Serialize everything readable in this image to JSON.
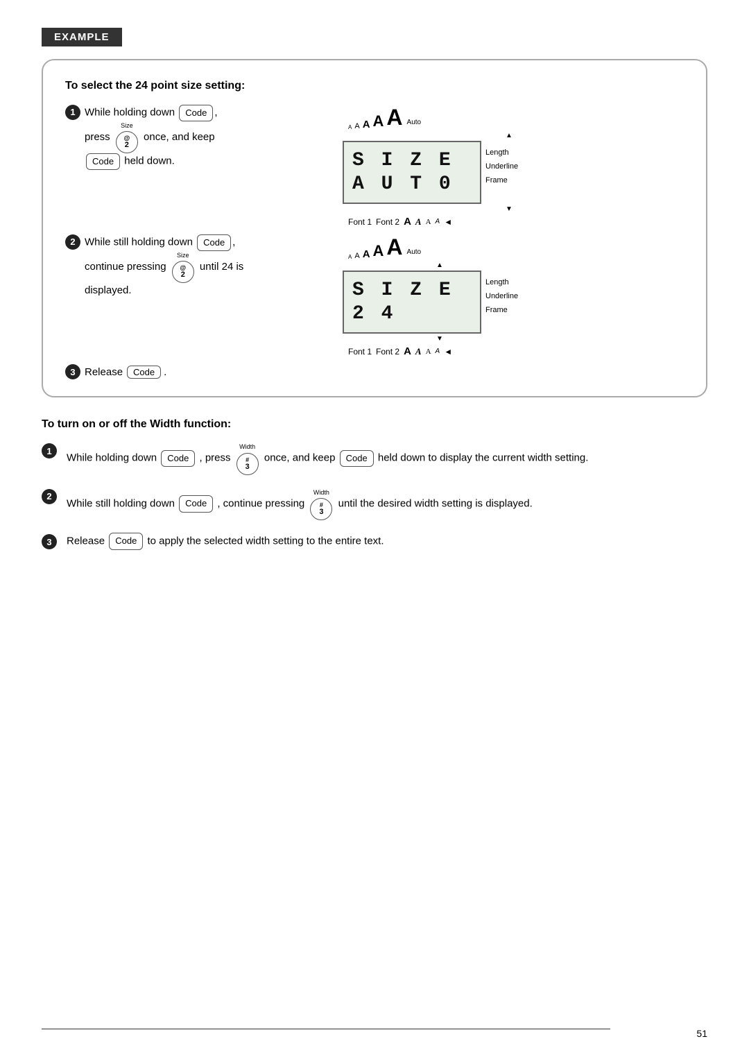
{
  "badge": "EXAMPLE",
  "example_box": {
    "title": "To select the 24 point size setting:",
    "step1": {
      "num": "1",
      "text_before": "While  holding  down",
      "key_code": "Code",
      "text_middle": ",",
      "key_size_label": "Size",
      "key_at_top": "@",
      "key_at_bot": "2",
      "text_after": "once,  and  keep",
      "key_code2": "Code",
      "text_end": "held down."
    },
    "step2": {
      "num": "2",
      "text_before": "While still holding down",
      "key_code": "Code",
      "text_middle": ",",
      "key_size_label": "Size",
      "key_at_top": "@",
      "key_at_bot": "2",
      "text_after": "until 24 is",
      "text_continue": "continue pressing",
      "text_displayed": "displayed."
    },
    "step3": {
      "num": "3",
      "text_before": "Release",
      "key_code": "Code",
      "text_after": "."
    },
    "display1": {
      "line1": "S I Z E",
      "line2": "A U T 0",
      "a_sizes": [
        "A",
        "A",
        "A",
        "A",
        "A"
      ],
      "auto_label": "Auto",
      "arrow_up": "▲",
      "arrow_down": "▼",
      "right_labels": [
        "Length",
        "Underline",
        "Frame"
      ],
      "font_row": [
        "Font 1",
        "Font 2",
        "A",
        "𝔸",
        "𝒜",
        "A",
        "◄"
      ]
    },
    "display2": {
      "line1": "S I Z E",
      "line2": "2 4",
      "a_sizes": [
        "A",
        "A",
        "A",
        "A",
        "A"
      ],
      "auto_label": "Auto",
      "arrow_up": "▲",
      "arrow_down": "▼",
      "right_labels": [
        "Length",
        "Underline",
        "Frame"
      ],
      "font_row": [
        "Font 1",
        "Font 2",
        "A",
        "𝔸",
        "𝒜",
        "A",
        "◄"
      ]
    }
  },
  "width_section": {
    "title": "To turn on or off the Width function:",
    "step1": {
      "num": "1",
      "text": "While holding down",
      "key_code1": "Code",
      "text2": ", press",
      "key_width_label": "Width",
      "key_hash_top": "#",
      "key_hash_bot": "3",
      "text3": "once, and keep",
      "key_code2": "Code",
      "text4": "held down to display the current width setting."
    },
    "step2": {
      "num": "2",
      "text": "While still holding down",
      "key_code": "Code",
      "text2": ", continue pressing",
      "key_width_label": "Width",
      "key_hash_top": "#",
      "key_hash_bot": "3",
      "text3": "until the desired width setting is displayed."
    },
    "step3": {
      "num": "3",
      "text": "Release",
      "key_code": "Code",
      "text2": "to apply the selected width setting to the entire text."
    }
  },
  "page_number": "51"
}
